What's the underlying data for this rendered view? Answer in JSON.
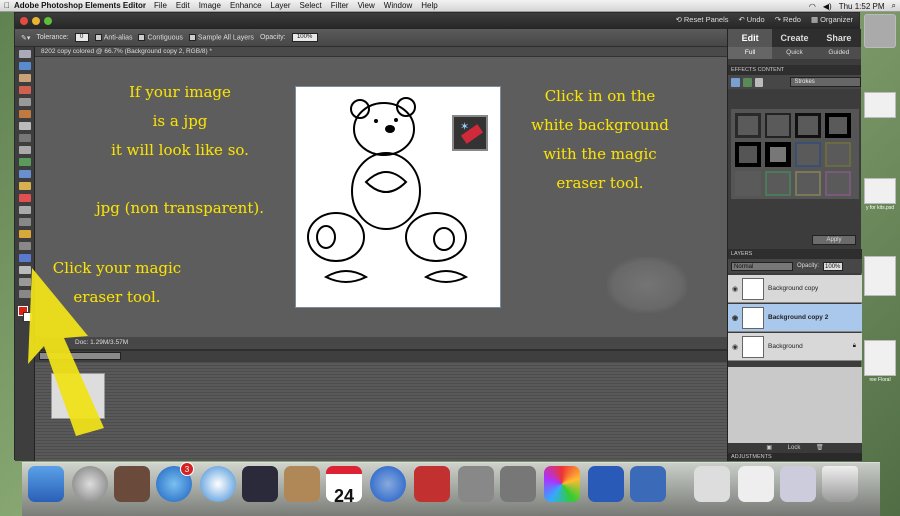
{
  "menubar": {
    "app_name": "Adobe Photoshop Elements Editor",
    "items": [
      "File",
      "Edit",
      "Image",
      "Enhance",
      "Layer",
      "Select",
      "Filter",
      "View",
      "Window",
      "Help"
    ],
    "clock": "Thu 1:52 PM"
  },
  "titlebar": {
    "reset_panels": "Reset Panels",
    "undo": "Undo",
    "redo": "Redo",
    "organizer": "Organizer"
  },
  "options_bar": {
    "tolerance_label": "Tolerance:",
    "tolerance_value": "0",
    "anti_alias": "Anti-alias",
    "contiguous": "Contiguous",
    "sample_all_layers": "Sample All Layers",
    "opacity_label": "Opacity:",
    "opacity_value": "100%"
  },
  "document": {
    "tab_title": "8202 copy colored @ 66.7% (Background copy 2, RGB/8) *",
    "status": "Doc: 1.29M/3.57M"
  },
  "overlay": {
    "left_top": [
      "If your image",
      "is a jpg",
      "it will look like so.",
      "",
      "jpg (non transparent)."
    ],
    "left_bottom": [
      "Click your magic",
      "eraser tool."
    ],
    "right": [
      "Click in on the",
      "white background",
      "with the magic",
      "eraser tool."
    ]
  },
  "panel": {
    "tabs": [
      "Edit",
      "Create",
      "Share"
    ],
    "subtabs": [
      "Full",
      "Quick",
      "Guided"
    ],
    "effects_header": "EFFECTS  CONTENT",
    "effects_dropdown": "Strokes",
    "apply_label": "Apply",
    "layers_header": "LAYERS",
    "blend_mode": "Normal",
    "opacity_label": "Opacity:",
    "opacity_value": "100%",
    "layers": [
      "Background copy",
      "Background copy 2",
      "Background"
    ],
    "lock_label": "Lock",
    "adjustments_header": "ADJUSTMENTS"
  },
  "desktop_icons": [
    "y for kits.psd",
    "ree Floral"
  ],
  "dock": {
    "calendar_day": "24",
    "appstore_badge": "3"
  }
}
